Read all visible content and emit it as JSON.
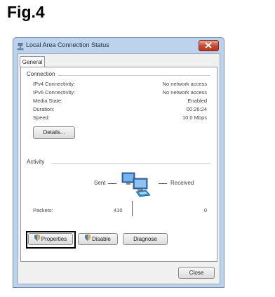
{
  "figure_label": "Fig.4",
  "window": {
    "title": "Local Area Connection Status"
  },
  "tabs": [
    {
      "label": "General"
    }
  ],
  "connection": {
    "group_label": "Connection",
    "rows": [
      {
        "label": "IPv4 Connectivity:",
        "value": "No network access"
      },
      {
        "label": "IPv6 Connectivity:",
        "value": "No network access"
      },
      {
        "label": "Media State:",
        "value": "Enabled"
      },
      {
        "label": "Duration:",
        "value": "00:26:24"
      },
      {
        "label": "Speed:",
        "value": "10.0 Mbps"
      }
    ],
    "details_label": "Details..."
  },
  "activity": {
    "group_label": "Activity",
    "sent_label": "Sent",
    "received_label": "Received",
    "packets_label": "Packets:",
    "packets_sent": "410",
    "packets_received": "0"
  },
  "buttons": {
    "properties": "Properties",
    "disable": "Disable",
    "diagnose": "Diagnose",
    "close": "Close"
  },
  "icons": {
    "app": "network-connection-icon",
    "activity": "network-computers-icon",
    "properties": "shield-icon",
    "disable": "shield-icon"
  },
  "colors": {
    "titlebar": "#bdd3ec",
    "close_button": "#c64b35",
    "highlight_box": "#000000"
  }
}
